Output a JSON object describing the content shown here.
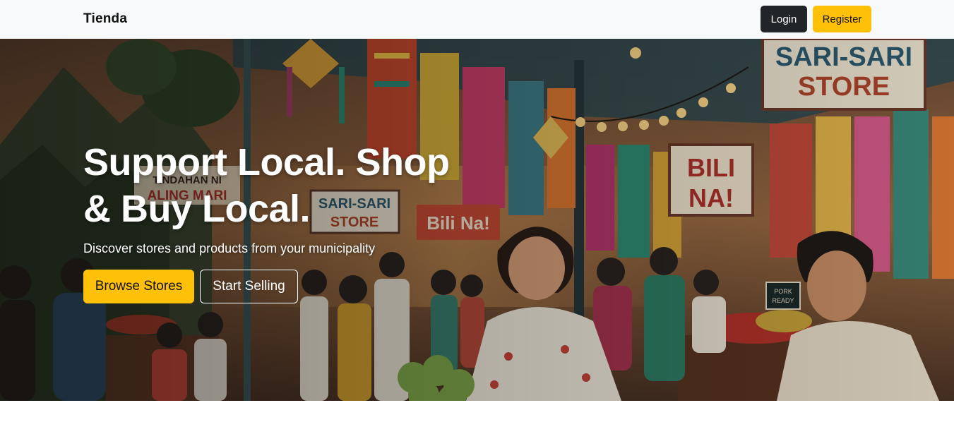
{
  "navbar": {
    "brand": "Tienda",
    "login_label": "Login",
    "register_label": "Register"
  },
  "hero": {
    "title_line1": "Support Local. Shop",
    "title_line2": "& Buy Local.",
    "subtitle": "Discover stores and products from your municipality",
    "browse_label": "Browse Stores",
    "sell_label": "Start Selling",
    "image_signs": {
      "sari_sari_large": "SARI-SARI STORE",
      "bili_na_right": "BILI NA!",
      "sari_sari_small": "SARI-SARI STORE",
      "bili_na_center": "Bili Na!",
      "tindahan": "TINDAHAN NI ALING MARI",
      "pork_sign": "PORK READY"
    }
  },
  "colors": {
    "accent_yellow": "#ffc107",
    "dark_button": "#212529",
    "navbar_bg": "#f8f9fa"
  }
}
